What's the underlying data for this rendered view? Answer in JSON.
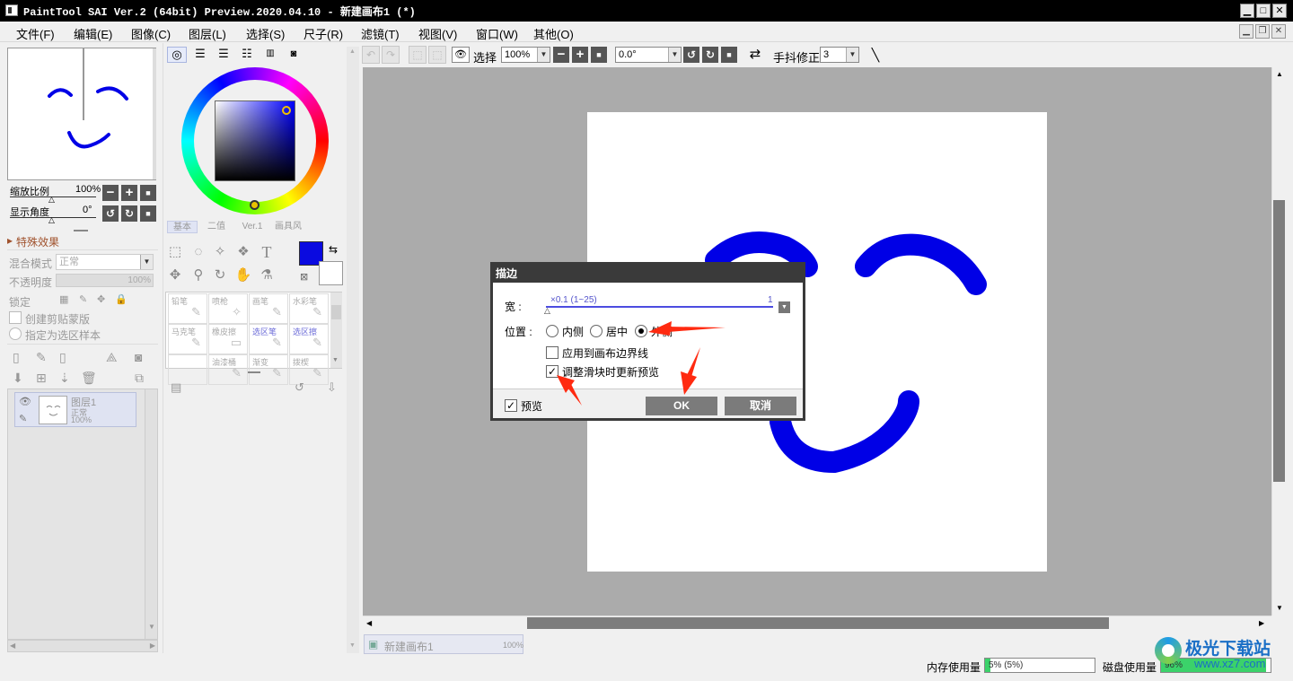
{
  "window": {
    "title": "PaintTool SAI Ver.2 (64bit) Preview.2020.04.10 - 新建画布1 (*)",
    "minimize": "▁",
    "maximize": "□",
    "close": "✕"
  },
  "menu": [
    "文件(F)",
    "编辑(E)",
    "图像(C)",
    "图层(L)",
    "选择(S)",
    "尺子(R)",
    "滤镜(T)",
    "视图(V)",
    "窗口(W)",
    "其他(O)"
  ],
  "navigator": {
    "zoom_label": "缩放比例",
    "zoom_value": "100%",
    "angle_label": "显示角度",
    "angle_value": "0°"
  },
  "layer_panel": {
    "effects_label": "特殊效果",
    "blend_label": "混合模式",
    "blend_value": "正常",
    "opacity_label": "不透明度",
    "opacity_value": "100%",
    "lock_label": "锁定",
    "clip_label": "创建剪贴蒙版",
    "selection_source_label": "指定为选区样本",
    "layer_name": "图层1",
    "layer_mode": "正常",
    "layer_opacity": "100%"
  },
  "color_panel": {
    "tabs": [
      "基本",
      "二值",
      "Ver.1",
      "画具风"
    ],
    "primary_color": "#0a0ae0",
    "secondary_color": "#ffffff"
  },
  "brushes": [
    {
      "name": "铅笔",
      "active": false
    },
    {
      "name": "喷枪",
      "active": false
    },
    {
      "name": "画笔",
      "active": false
    },
    {
      "name": "水彩笔",
      "active": false
    },
    {
      "name": "马克笔",
      "active": false
    },
    {
      "name": "橡皮擦",
      "active": false
    },
    {
      "name": "选区笔",
      "active": true
    },
    {
      "name": "选区擦",
      "active": true
    },
    {
      "name": "",
      "active": false
    },
    {
      "name": "油漆桶",
      "active": false
    },
    {
      "name": "渐变",
      "active": false
    },
    {
      "name": "拨楔",
      "active": false
    }
  ],
  "toolbar": {
    "select_label": "选择",
    "zoom_value": "100%",
    "angle_value": "0.0°",
    "stabilizer_label": "手抖修正",
    "stabilizer_value": "3"
  },
  "canvas_tab": {
    "name": "新建画布1",
    "zoom": "100%"
  },
  "status": {
    "memory_label": "内存使用量",
    "memory_value": "5% (5%)",
    "memory_fraction": 0.05,
    "disk_label": "磁盘使用量",
    "disk_value": "96%",
    "disk_fraction": 0.96
  },
  "dialog": {
    "title": "描边",
    "width_label": "宽 :",
    "width_hint": "×0.1 (1~25)",
    "width_value": "1",
    "position_label": "位置 :",
    "options": [
      "内侧",
      "居中",
      "外侧"
    ],
    "selected_option": "外侧",
    "apply_border_label": "应用到画布边界线",
    "apply_border_checked": false,
    "live_update_label": "调整滑块时更新预览",
    "live_update_checked": true,
    "preview_label": "预览",
    "preview_checked": true,
    "ok_label": "OK",
    "cancel_label": "取消"
  },
  "watermark": {
    "brand": "极光下载站",
    "url": "www.xz7.com"
  },
  "colors": {
    "stroke": "#0000e6",
    "arrow": "#ff2a10",
    "workspace": "#ababab",
    "dialog_header": "#3a3a3a"
  }
}
